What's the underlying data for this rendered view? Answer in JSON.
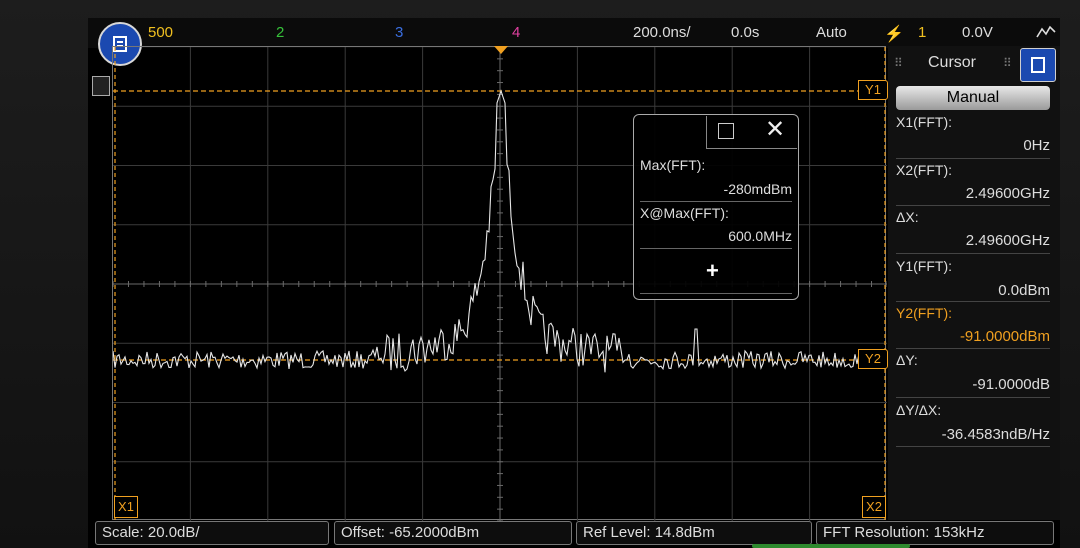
{
  "topbar": {
    "ch1_scale": "500",
    "ch2": "2",
    "ch3": "3",
    "ch4": "4",
    "timebase": "200.0ns/",
    "delay": "0.0s",
    "trigger_mode": "Auto",
    "trigger_source": "1",
    "trigger_level": "0.0V"
  },
  "markers": {
    "y1": "Y1",
    "y2": "Y2",
    "x1": "X1",
    "x2": "X2"
  },
  "popup": {
    "max_label": "Max(FFT):",
    "max_value": "-280mdBm",
    "xatmax_label": "X@Max(FFT):",
    "xatmax_value": "600.0MHz"
  },
  "cursor_panel": {
    "title": "Cursor",
    "mode": "Manual",
    "x1_label": "X1(FFT):",
    "x1_value": "0Hz",
    "x2_label": "X2(FFT):",
    "x2_value": "2.49600GHz",
    "dx_label": "ΔX:",
    "dx_value": "2.49600GHz",
    "y1_label": "Y1(FFT):",
    "y1_value": "0.0dBm",
    "y2_label": "Y2(FFT):",
    "y2_value": "-91.0000dBm",
    "dy_label": "ΔY:",
    "dy_value": "-91.0000dB",
    "dydx_label": "ΔY/ΔX:",
    "dydx_value": "-36.4583ndB/Hz"
  },
  "status": {
    "scale": "Scale: 20.0dB/",
    "offset": "Offset: -65.2000dBm",
    "ref_level": "Ref Level: 14.8dBm",
    "fft_resolution": "FFT Resolution: 153kHz"
  },
  "colors": {
    "ch1": "#f0c020",
    "ch2": "#36c23a",
    "ch3": "#3a6ee0",
    "ch4": "#e040a0",
    "cursor": "#f0a020",
    "accent": "#1b49b0"
  },
  "icons": {
    "menu": "menu-icon",
    "close": "close-icon",
    "add": "plus-icon",
    "trigger": "trigger-edge-icon"
  }
}
